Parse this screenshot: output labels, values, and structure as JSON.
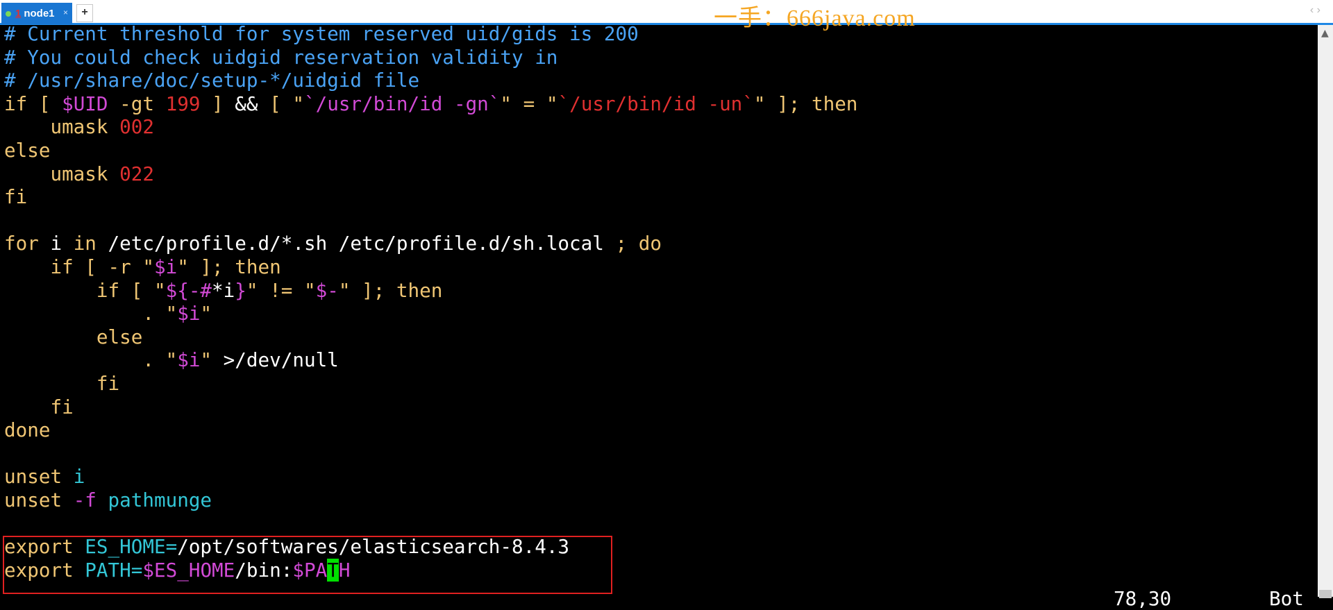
{
  "tabbar": {
    "tab_number": "1",
    "tab_label": "node1",
    "close_glyph": "×",
    "add_glyph": "+",
    "watermark": "一手：666java.com",
    "nav_arrows": "‹ ›"
  },
  "terminal": {
    "lines": [
      [
        {
          "t": "# Current threshold for system reserved uid/gids is 200",
          "c": "cmt"
        }
      ],
      [
        {
          "t": "# You could check uidgid reservation validity in",
          "c": "cmt"
        }
      ],
      [
        {
          "t": "# /usr/share/doc/setup-*/uidgid file",
          "c": "cmt"
        }
      ],
      [
        {
          "t": "if [ ",
          "c": "kw"
        },
        {
          "t": "$UID",
          "c": "var"
        },
        {
          "t": " -gt ",
          "c": "kw"
        },
        {
          "t": "199",
          "c": "num"
        },
        {
          "t": " ] ",
          "c": "kw"
        },
        {
          "t": "&&",
          "c": "pth"
        },
        {
          "t": " [ \"",
          "c": "kw"
        },
        {
          "t": "`/usr/bin/id -gn`",
          "c": "str"
        },
        {
          "t": "\" = \"",
          "c": "kw"
        },
        {
          "t": "`/usr/bin/id -un`",
          "c": "num"
        },
        {
          "t": "\" ]; then",
          "c": "kw"
        }
      ],
      [
        {
          "t": "    umask ",
          "c": "kw"
        },
        {
          "t": "002",
          "c": "num"
        }
      ],
      [
        {
          "t": "else",
          "c": "kw"
        }
      ],
      [
        {
          "t": "    umask ",
          "c": "kw"
        },
        {
          "t": "022",
          "c": "num"
        }
      ],
      [
        {
          "t": "fi",
          "c": "kw"
        }
      ],
      [],
      [
        {
          "t": "for",
          "c": "kw"
        },
        {
          "t": " i ",
          "c": "pth"
        },
        {
          "t": "in",
          "c": "kw"
        },
        {
          "t": " /etc/profile.d/*.sh /etc/profile.d/sh.local ",
          "c": "pth"
        },
        {
          "t": "; do",
          "c": "kw"
        }
      ],
      [
        {
          "t": "    if [ -r \"",
          "c": "kw"
        },
        {
          "t": "$i",
          "c": "var"
        },
        {
          "t": "\" ]; then",
          "c": "kw"
        }
      ],
      [
        {
          "t": "        if [ \"",
          "c": "kw"
        },
        {
          "t": "${-#",
          "c": "var"
        },
        {
          "t": "*i",
          "c": "pth"
        },
        {
          "t": "}",
          "c": "var"
        },
        {
          "t": "\" != \"",
          "c": "kw"
        },
        {
          "t": "$-",
          "c": "var"
        },
        {
          "t": "\" ]; then",
          "c": "kw"
        }
      ],
      [
        {
          "t": "            . \"",
          "c": "kw"
        },
        {
          "t": "$i",
          "c": "var"
        },
        {
          "t": "\"",
          "c": "kw"
        }
      ],
      [
        {
          "t": "        else",
          "c": "kw"
        }
      ],
      [
        {
          "t": "            . \"",
          "c": "kw"
        },
        {
          "t": "$i",
          "c": "var"
        },
        {
          "t": "\" ",
          "c": "kw"
        },
        {
          "t": ">/dev/null",
          "c": "pth"
        }
      ],
      [
        {
          "t": "        fi",
          "c": "kw"
        }
      ],
      [
        {
          "t": "    fi",
          "c": "kw"
        }
      ],
      [
        {
          "t": "done",
          "c": "kw"
        }
      ],
      [],
      [
        {
          "t": "unset",
          "c": "kw"
        },
        {
          "t": " i",
          "c": "cyan"
        }
      ],
      [
        {
          "t": "unset",
          "c": "kw"
        },
        {
          "t": " -f",
          "c": "var"
        },
        {
          "t": " pathmunge",
          "c": "cyan"
        }
      ],
      [],
      [
        {
          "t": "export",
          "c": "kw"
        },
        {
          "t": " ES_HOME=",
          "c": "cyan"
        },
        {
          "t": "/opt/softwares/elasticsearch-8.4.3",
          "c": "pth"
        }
      ],
      [
        {
          "t": "export",
          "c": "kw"
        },
        {
          "t": " PATH=",
          "c": "cyan"
        },
        {
          "t": "$ES_HOME",
          "c": "var"
        },
        {
          "t": "/bin:",
          "c": "pth"
        },
        {
          "t": "$PA",
          "c": "var"
        },
        {
          "t": "T",
          "c": "cursor"
        },
        {
          "t": "H",
          "c": "var"
        }
      ]
    ],
    "status_position": "78,30",
    "status_scroll": "Bot"
  }
}
